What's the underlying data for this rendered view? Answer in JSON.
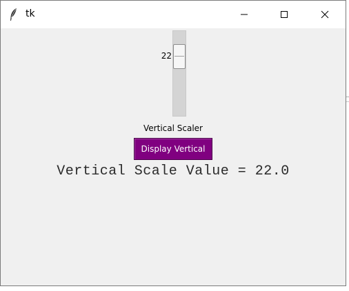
{
  "window": {
    "title": "tk",
    "controls": {
      "minimize": "minimize",
      "maximize": "maximize",
      "close": "close"
    }
  },
  "scale": {
    "orient": "vertical",
    "from": 0,
    "to": 100,
    "value": 22,
    "value_display": "22",
    "label": "Vertical Scaler"
  },
  "button": {
    "label": "Display Vertical",
    "bg_color": "#800080",
    "fg_color": "#ffffff"
  },
  "result": {
    "text": "Vertical Scale Value = 22.0"
  }
}
